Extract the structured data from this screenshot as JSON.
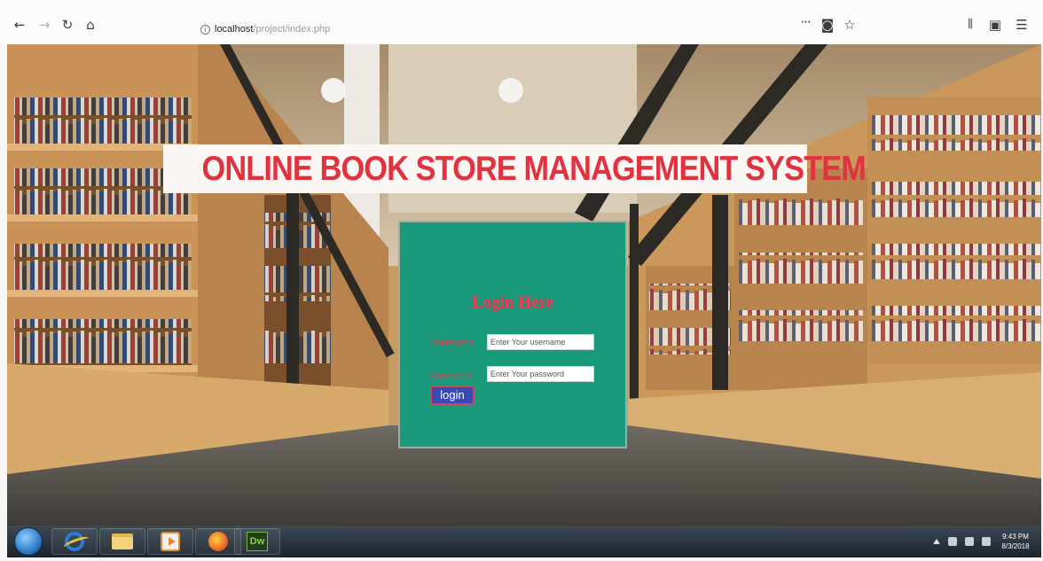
{
  "browser": {
    "url_host": "localhost",
    "url_path": "/project/index.php",
    "menu_ellipsis": "···"
  },
  "page": {
    "banner_title": "ONLINE BOOK STORE MANAGEMENT SYSTEM",
    "login": {
      "title": "Login Here",
      "username_label": "Username",
      "username_placeholder": "Enter Your username",
      "password_label": "Password",
      "password_placeholder": "Enter Your password",
      "button_label": "login"
    }
  },
  "taskbar": {
    "apps": [
      "Internet Explorer",
      "Windows Explorer",
      "Media Player",
      "Firefox",
      "Dreamweaver"
    ],
    "dw_label": "Dw",
    "clock_time": "9:43 PM",
    "clock_date": "8/3/2018"
  },
  "colors": {
    "banner_text": "#e0323f",
    "login_panel": "#1a9a7a",
    "login_button": "#3a4ab4"
  }
}
